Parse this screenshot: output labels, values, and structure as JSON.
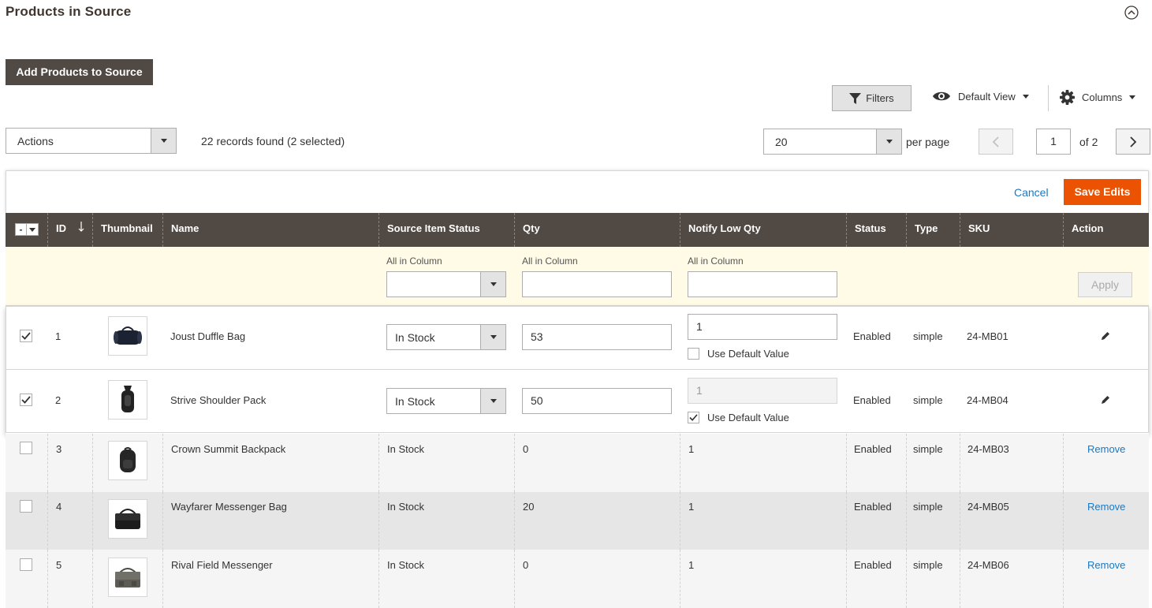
{
  "section": {
    "title": "Products in Source"
  },
  "toolbar": {
    "add_button": "Add Products to Source",
    "filters_label": "Filters",
    "view_label": "Default View",
    "columns_label": "Columns"
  },
  "grid_controls": {
    "actions_value": "Actions",
    "records_text": "22 records found (2 selected)",
    "per_page_value": "20",
    "per_page_label": "per page",
    "current_page": "1",
    "total_pages_text": "of 2"
  },
  "edit_bar": {
    "cancel_label": "Cancel",
    "save_label": "Save Edits"
  },
  "columns": {
    "id": "ID",
    "thumbnail": "Thumbnail",
    "name": "Name",
    "source_item_status": "Source Item Status",
    "qty": "Qty",
    "notify_low_qty": "Notify Low Qty",
    "status": "Status",
    "type": "Type",
    "sku": "SKU",
    "action": "Action"
  },
  "mass_edit": {
    "all_in_column": "All in Column",
    "apply_label": "Apply"
  },
  "use_default_label": "Use Default Value",
  "remove_label": "Remove",
  "edit_rows": [
    {
      "id": "1",
      "name": "Joust Duffle Bag",
      "source_status": "In Stock",
      "qty": "53",
      "notify": "1",
      "status": "Enabled",
      "type": "simple",
      "sku": "24-MB01"
    },
    {
      "id": "2",
      "name": "Strive Shoulder Pack",
      "source_status": "In Stock",
      "qty": "50",
      "notify": "1",
      "status": "Enabled",
      "type": "simple",
      "sku": "24-MB04"
    }
  ],
  "rows": [
    {
      "id": "3",
      "name": "Crown Summit Backpack",
      "source_status": "In Stock",
      "qty": "0",
      "notify": "1",
      "status": "Enabled",
      "type": "simple",
      "sku": "24-MB03"
    },
    {
      "id": "4",
      "name": "Wayfarer Messenger Bag",
      "source_status": "In Stock",
      "qty": "20",
      "notify": "1",
      "status": "Enabled",
      "type": "simple",
      "sku": "24-MB05"
    },
    {
      "id": "5",
      "name": "Rival Field Messenger",
      "source_status": "In Stock",
      "qty": "0",
      "notify": "1",
      "status": "Enabled",
      "type": "simple",
      "sku": "24-MB06"
    }
  ],
  "colors": {
    "header_bg": "#514943",
    "accent": "#eb5202",
    "link": "#1979c3",
    "mass_edit_bg": "#fffbe6"
  }
}
